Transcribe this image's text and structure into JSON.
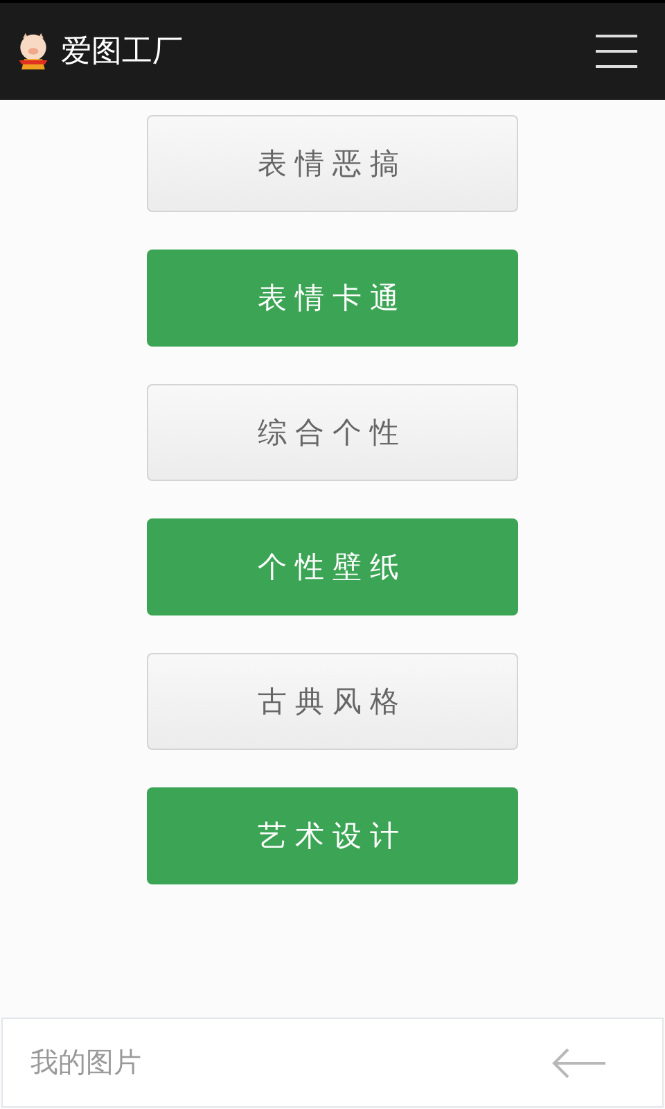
{
  "header": {
    "title": "爱图工厂"
  },
  "categories": [
    {
      "label": "表情恶搞",
      "kind": "light"
    },
    {
      "label": "表情卡通",
      "kind": "solid"
    },
    {
      "label": "综合个性",
      "kind": "light"
    },
    {
      "label": "个性壁纸",
      "kind": "solid"
    },
    {
      "label": "古典风格",
      "kind": "light"
    },
    {
      "label": "艺术设计",
      "kind": "solid"
    }
  ],
  "bottom_bar": {
    "label": "我的图片"
  }
}
